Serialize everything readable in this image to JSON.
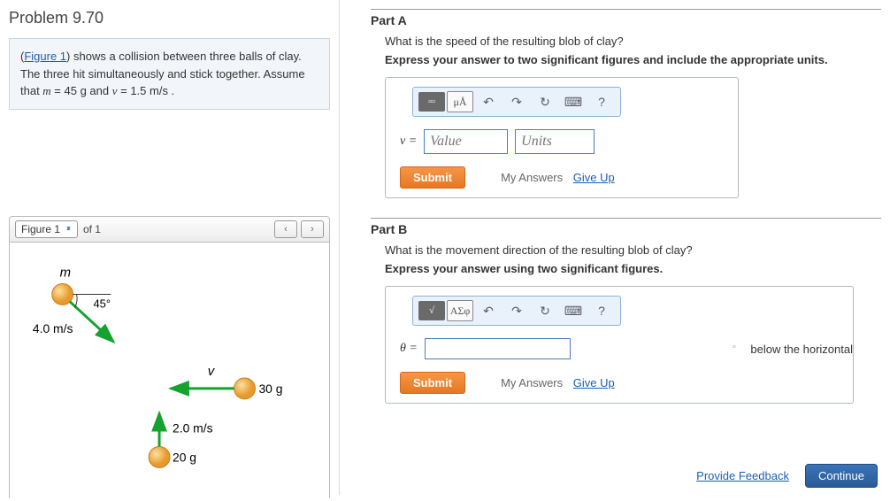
{
  "title": "Problem 9.70",
  "problem": {
    "figure_link": "Figure 1",
    "text1": " shows a collision between three balls of clay. The three hit simultaneously and stick together. Assume that ",
    "mass_var": "m",
    "mass_val": " = 45  g and ",
    "vel_var": "v",
    "vel_val": " = 1.5  m/s ."
  },
  "figure_selector": {
    "label": "Figure 1",
    "of": "of 1"
  },
  "figure": {
    "m": "m",
    "angle": "45°",
    "v1": "4.0 m/s",
    "vlabel": "v",
    "m2": "30 g",
    "v3": "2.0 m/s",
    "m3": "20 g"
  },
  "partA": {
    "label": "Part A",
    "question": "What is the speed of the resulting blob of clay?",
    "instruction": "Express your answer to two significant figures and include the appropriate units.",
    "var": "v =",
    "value_ph": "Value",
    "units_ph": "Units",
    "tool_units": "μÅ"
  },
  "partB": {
    "label": "Part B",
    "question": "What is the movement direction of the resulting blob of clay?",
    "instruction": "Express your answer using two significant figures.",
    "var": "θ =",
    "tool_greek": "ΑΣφ",
    "suffix_deg": "°",
    "suffix_text": "below the horizontal"
  },
  "buttons": {
    "submit": "Submit",
    "my_answers": "My Answers",
    "give_up": "Give Up",
    "feedback": "Provide Feedback",
    "continue": "Continue",
    "help": "?"
  }
}
